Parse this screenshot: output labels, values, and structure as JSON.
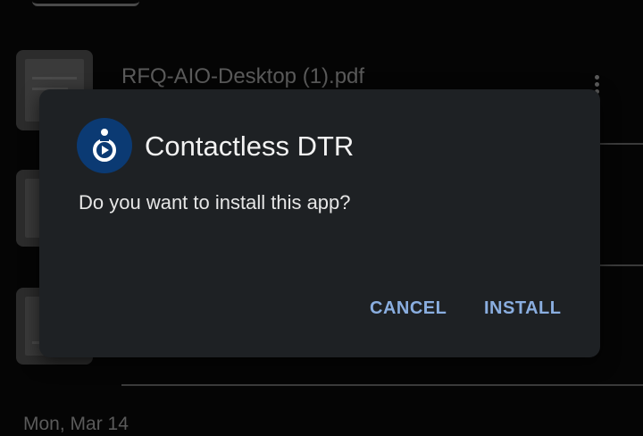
{
  "background": {
    "file_name": "RFQ-AIO-Desktop (1).pdf",
    "date_header": "Mon, Mar 14"
  },
  "dialog": {
    "app_name": "Contactless DTR",
    "prompt": "Do you want to install this app?",
    "cancel_label": "CANCEL",
    "install_label": "INSTALL",
    "accent_color": "#8aaee0",
    "icon": "contactless-dtr-app-icon"
  }
}
